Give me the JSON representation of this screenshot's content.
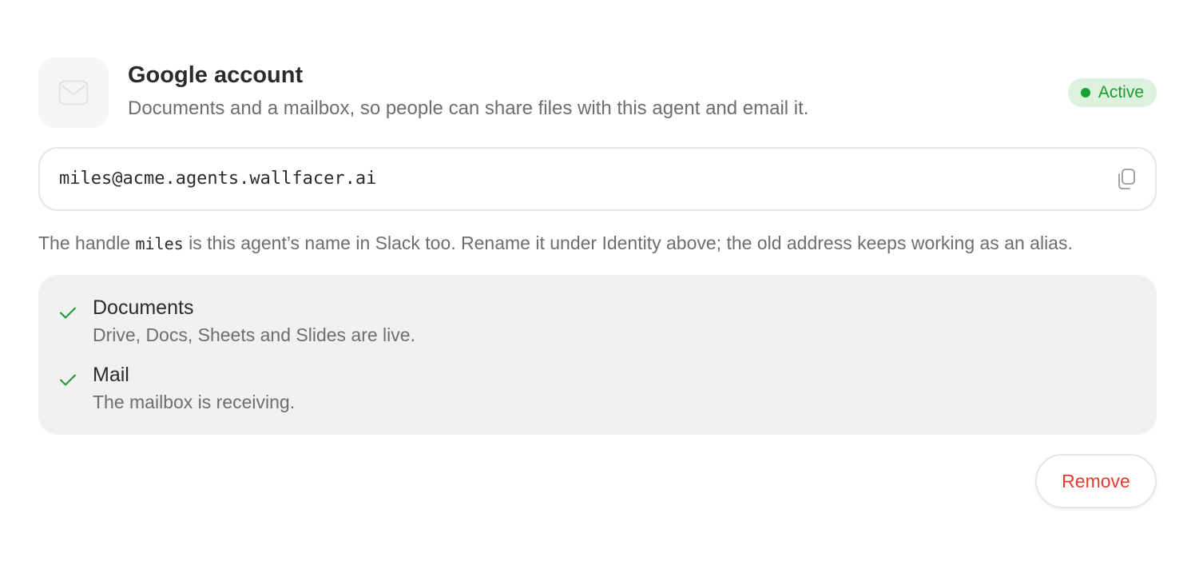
{
  "integration": {
    "title": "Google account",
    "description": "Documents and a mailbox, so people can share files with this agent and email it.",
    "icon": "mail-icon",
    "status": {
      "label": "Active",
      "color": "#16a332",
      "background": "#dcf2df"
    }
  },
  "address": {
    "value": "miles@acme.agents.wallfacer.ai",
    "copy_icon": "copy-icon"
  },
  "hint": {
    "prefix": "The handle ",
    "handle": "miles",
    "suffix": " is this agent’s name in Slack too. Rename it under Identity above; the old address keeps working as an alias."
  },
  "services": [
    {
      "name": "Documents",
      "detail": "Drive, Docs, Sheets and Slides are live.",
      "icon": "check-icon"
    },
    {
      "name": "Mail",
      "detail": "The mailbox is receiving.",
      "icon": "check-icon"
    }
  ],
  "actions": {
    "remove_label": "Remove",
    "remove_color": "#e53a2e"
  }
}
